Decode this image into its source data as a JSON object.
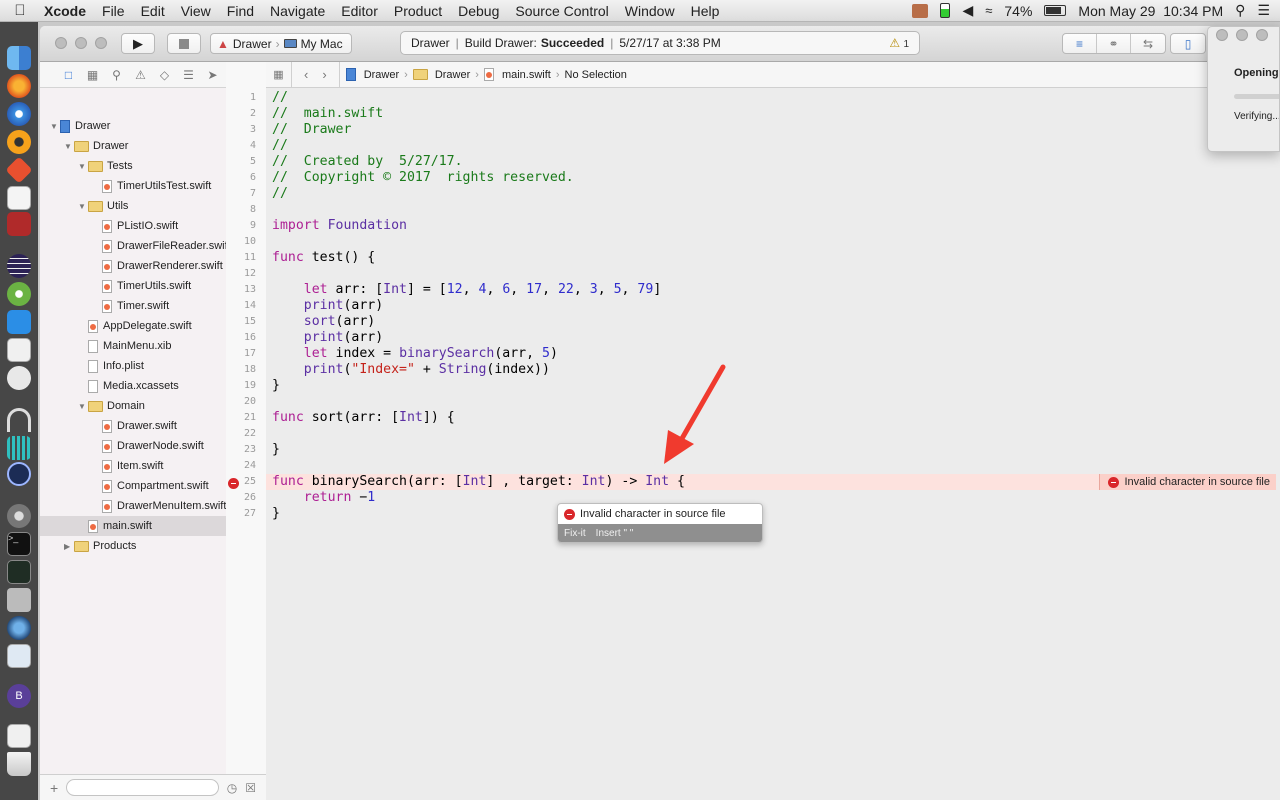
{
  "menubar": {
    "app": "Xcode",
    "items": [
      "File",
      "Edit",
      "View",
      "Find",
      "Navigate",
      "Editor",
      "Product",
      "Debug",
      "Source Control",
      "Window",
      "Help"
    ],
    "battery_percent": "74%",
    "clock": "Mon May 29  10:34 PM"
  },
  "toolbar": {
    "scheme_target": "Drawer",
    "scheme_device": "My Mac",
    "activity": {
      "project": "Drawer",
      "status_prefix": "Build Drawer:",
      "status": "Succeeded",
      "timestamp": "5/27/17 at 3:38 PM",
      "warning_count": "1"
    }
  },
  "navigator": {
    "tree": [
      {
        "label": "Drawer",
        "kind": "project",
        "depth": 0,
        "open": true
      },
      {
        "label": "Drawer",
        "kind": "folder",
        "depth": 1,
        "open": true
      },
      {
        "label": "Tests",
        "kind": "folder",
        "depth": 2,
        "open": true
      },
      {
        "label": "TimerUtilsTest.swift",
        "kind": "swift",
        "depth": 3
      },
      {
        "label": "Utils",
        "kind": "folder",
        "depth": 2,
        "open": true
      },
      {
        "label": "PListIO.swift",
        "kind": "swift",
        "depth": 3
      },
      {
        "label": "DrawerFileReader.swift",
        "kind": "swift",
        "depth": 3
      },
      {
        "label": "DrawerRenderer.swift",
        "kind": "swift",
        "depth": 3
      },
      {
        "label": "TimerUtils.swift",
        "kind": "swift",
        "depth": 3
      },
      {
        "label": "Timer.swift",
        "kind": "swift",
        "depth": 3
      },
      {
        "label": "AppDelegate.swift",
        "kind": "swift",
        "depth": 2
      },
      {
        "label": "MainMenu.xib",
        "kind": "file",
        "depth": 2
      },
      {
        "label": "Info.plist",
        "kind": "file",
        "depth": 2
      },
      {
        "label": "Media.xcassets",
        "kind": "file",
        "depth": 2
      },
      {
        "label": "Domain",
        "kind": "folder",
        "depth": 2,
        "open": true
      },
      {
        "label": "Drawer.swift",
        "kind": "swift",
        "depth": 3
      },
      {
        "label": "DrawerNode.swift",
        "kind": "swift",
        "depth": 3
      },
      {
        "label": "Item.swift",
        "kind": "swift",
        "depth": 3
      },
      {
        "label": "Compartment.swift",
        "kind": "swift",
        "depth": 3
      },
      {
        "label": "DrawerMenuItem.swift",
        "kind": "swift",
        "depth": 3
      },
      {
        "label": "main.swift",
        "kind": "swift",
        "depth": 2,
        "selected": true
      },
      {
        "label": "Products",
        "kind": "folder",
        "depth": 1,
        "open": false
      }
    ]
  },
  "jumpbar": {
    "crumbs": [
      "Drawer",
      "Drawer",
      "main.swift",
      "No Selection"
    ]
  },
  "editor": {
    "lines": [
      "//",
      "//  main.swift",
      "//  Drawer",
      "//",
      "//  Created by  5/27/17.",
      "//  Copyright © 2017  rights reserved.",
      "//",
      "",
      "import Foundation",
      "",
      "func test() {",
      "",
      "    let arr: [Int] = [12, 4, 6, 17, 22, 3, 5, 79]",
      "    print(arr)",
      "    sort(arr)",
      "    print(arr)",
      "    let index = binarySearch(arr, 5)",
      "    print(\"Index=\" + String(index))",
      "}",
      "",
      "func sort(arr: [Int]) {",
      "",
      "}",
      "",
      "func binarySearch(arr: [Int] , target: Int) -> Int {",
      "    return −1",
      "}"
    ],
    "error_line": 25,
    "inline_error": "Invalid character in source file"
  },
  "popover": {
    "message": "Invalid character in source file",
    "fixit_label": "Fix-it",
    "fixit_action": "Insert \" \""
  },
  "background_dialog": {
    "title": "Opening",
    "status": "Verifying..."
  },
  "colors": {
    "keyword": "#ad1f93",
    "comment": "#1a7a1a",
    "type": "#5b2fa3",
    "number": "#2f2ccc",
    "string": "#c4221a",
    "error": "#d9262a",
    "error_line_bg": "#fde2de",
    "arrow": "#f03a2e"
  }
}
